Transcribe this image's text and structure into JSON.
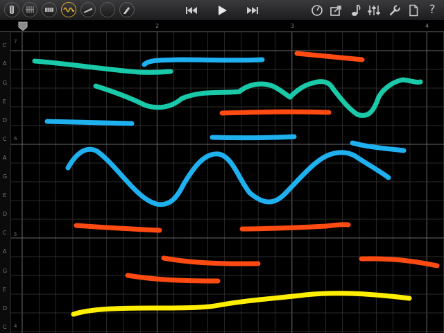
{
  "toolbar": {
    "left_buttons": [
      {
        "name": "instrument-icon",
        "active": false
      },
      {
        "name": "grid-icon",
        "active": false
      },
      {
        "name": "keyboard-icon",
        "active": false
      },
      {
        "name": "wave-icon",
        "active": true
      },
      {
        "name": "slide-icon",
        "active": false
      },
      {
        "name": "empty-icon",
        "active": false
      },
      {
        "name": "pen-icon",
        "active": false
      }
    ],
    "transport": [
      "rewind-icon",
      "play-icon",
      "fast-forward-icon"
    ],
    "right_buttons": [
      "metronome-icon",
      "share-icon",
      "note-icon",
      "mixer-icon",
      "wrench-icon",
      "document-icon",
      "help-icon"
    ],
    "help_label": "?"
  },
  "ruler": {
    "bars": [
      "2",
      "3",
      "4"
    ]
  },
  "keys": {
    "notes": [
      "C",
      "A",
      "G",
      "E",
      "D",
      "C",
      "A",
      "G",
      "E",
      "D",
      "C",
      "A",
      "G",
      "E",
      "D",
      "C"
    ],
    "octaves": [
      "7",
      "6",
      "5",
      "4"
    ]
  },
  "colors": {
    "teal": "#19c9a8",
    "blue": "#1fb0f0",
    "orange": "#ff4a12",
    "yellow": "#ffee00",
    "grid": "#3a3a3a",
    "grid_major": "#6a6a6a"
  }
}
